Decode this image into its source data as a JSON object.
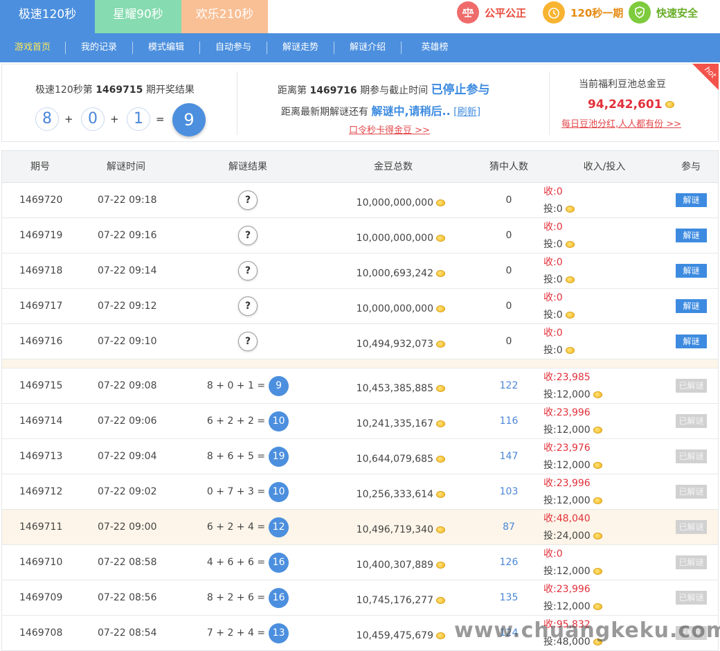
{
  "mode_tabs": [
    "极速120秒",
    "星耀90秒",
    "欢乐210秒"
  ],
  "badges": [
    {
      "label": "公平公正",
      "icon": "scales-icon"
    },
    {
      "label": "120秒一期",
      "icon": "clock-icon"
    },
    {
      "label": "快速安全",
      "icon": "shield-check-icon"
    }
  ],
  "nav": [
    "游戏首页",
    "我的记录",
    "模式编辑",
    "自动参与",
    "解谜走势",
    "解谜介绍",
    "英雄榜"
  ],
  "info": {
    "draw_prefix": "极速120秒第",
    "draw_period": "1469715",
    "draw_suffix": "期开奖结果",
    "draw_numbers": [
      "8",
      "0",
      "1"
    ],
    "draw_plus": "+",
    "draw_equals": "=",
    "draw_result": "9",
    "deadline_prefix": "距离第",
    "deadline_period": "1469716",
    "deadline_suffix": "期参与截止时间",
    "deadline_status": "已停止参与",
    "latest_prefix": "距离最新期解谜还有",
    "latest_status": "解谜中,请稍后..",
    "refresh": "[刷新]",
    "promo_link": "口令秒卡得金豆 >>",
    "pool_title": "当前福利豆池总金豆",
    "pool_amount": "94,242,601",
    "pool_link": "每日豆池分红,人人都有份 >>",
    "hot": "hot"
  },
  "table": {
    "headers": [
      "期号",
      "解谜时间",
      "解谜结果",
      "金豆总数",
      "猜中人数",
      "收入/投入",
      "参与"
    ],
    "income_label": "收:",
    "input_label": "投:",
    "rows": [
      {
        "id": "1469720",
        "time": "07-22 09:18",
        "pending": true,
        "result": "?",
        "total": "10,000,000,000",
        "winners": "0",
        "income": "0",
        "input": "0",
        "action": "解谜",
        "highlight": false
      },
      {
        "id": "1469719",
        "time": "07-22 09:16",
        "pending": true,
        "result": "?",
        "total": "10,000,000,000",
        "winners": "0",
        "income": "0",
        "input": "0",
        "action": "解谜",
        "highlight": false
      },
      {
        "id": "1469718",
        "time": "07-22 09:14",
        "pending": true,
        "result": "?",
        "total": "10,000,693,242",
        "winners": "0",
        "income": "0",
        "input": "0",
        "action": "解谜",
        "highlight": false
      },
      {
        "id": "1469717",
        "time": "07-22 09:12",
        "pending": true,
        "result": "?",
        "total": "10,000,000,000",
        "winners": "0",
        "income": "0",
        "input": "0",
        "action": "解谜",
        "highlight": false
      },
      {
        "id": "1469716",
        "time": "07-22 09:10",
        "pending": true,
        "result": "?",
        "total": "10,494,932,073",
        "winners": "0",
        "income": "0",
        "input": "0",
        "action": "解谜",
        "highlight": false
      },
      {
        "id": "1469715",
        "time": "07-22 09:08",
        "pending": false,
        "expr": "8 + 0 + 1 =",
        "result": "9",
        "total": "10,453,385,885",
        "winners": "122",
        "income": "23,985",
        "input": "12,000",
        "action": "已解谜",
        "highlight": false
      },
      {
        "id": "1469714",
        "time": "07-22 09:06",
        "pending": false,
        "expr": "6 + 2 + 2 =",
        "result": "10",
        "total": "10,241,335,167",
        "winners": "116",
        "income": "23,996",
        "input": "12,000",
        "action": "已解谜",
        "highlight": false
      },
      {
        "id": "1469713",
        "time": "07-22 09:04",
        "pending": false,
        "expr": "8 + 6 + 5 =",
        "result": "19",
        "total": "10,644,079,685",
        "winners": "147",
        "income": "23,976",
        "input": "12,000",
        "action": "已解谜",
        "highlight": false
      },
      {
        "id": "1469712",
        "time": "07-22 09:02",
        "pending": false,
        "expr": "0 + 7 + 3 =",
        "result": "10",
        "total": "10,256,333,614",
        "winners": "103",
        "income": "23,996",
        "input": "12,000",
        "action": "已解谜",
        "highlight": false
      },
      {
        "id": "1469711",
        "time": "07-22 09:00",
        "pending": false,
        "expr": "6 + 2 + 4 =",
        "result": "12",
        "total": "10,496,719,340",
        "winners": "87",
        "income": "48,040",
        "input": "24,000",
        "action": "已解谜",
        "highlight": true
      },
      {
        "id": "1469710",
        "time": "07-22 08:58",
        "pending": false,
        "expr": "4 + 6 + 6 =",
        "result": "16",
        "total": "10,400,307,889",
        "winners": "126",
        "income": "0",
        "input": "12,000",
        "action": "已解谜",
        "highlight": false
      },
      {
        "id": "1469709",
        "time": "07-22 08:56",
        "pending": false,
        "expr": "8 + 2 + 6 =",
        "result": "16",
        "total": "10,745,176,277",
        "winners": "135",
        "income": "23,996",
        "input": "12,000",
        "action": "已解谜",
        "highlight": false
      },
      {
        "id": "1469708",
        "time": "07-22 08:54",
        "pending": false,
        "expr": "7 + 2 + 4 =",
        "result": "13",
        "total": "10,459,475,679",
        "winners": "124",
        "income": "95,832",
        "input": "48,000",
        "action": "已解谜",
        "highlight": false
      }
    ]
  },
  "watermark": "www.chuangkeku.com"
}
